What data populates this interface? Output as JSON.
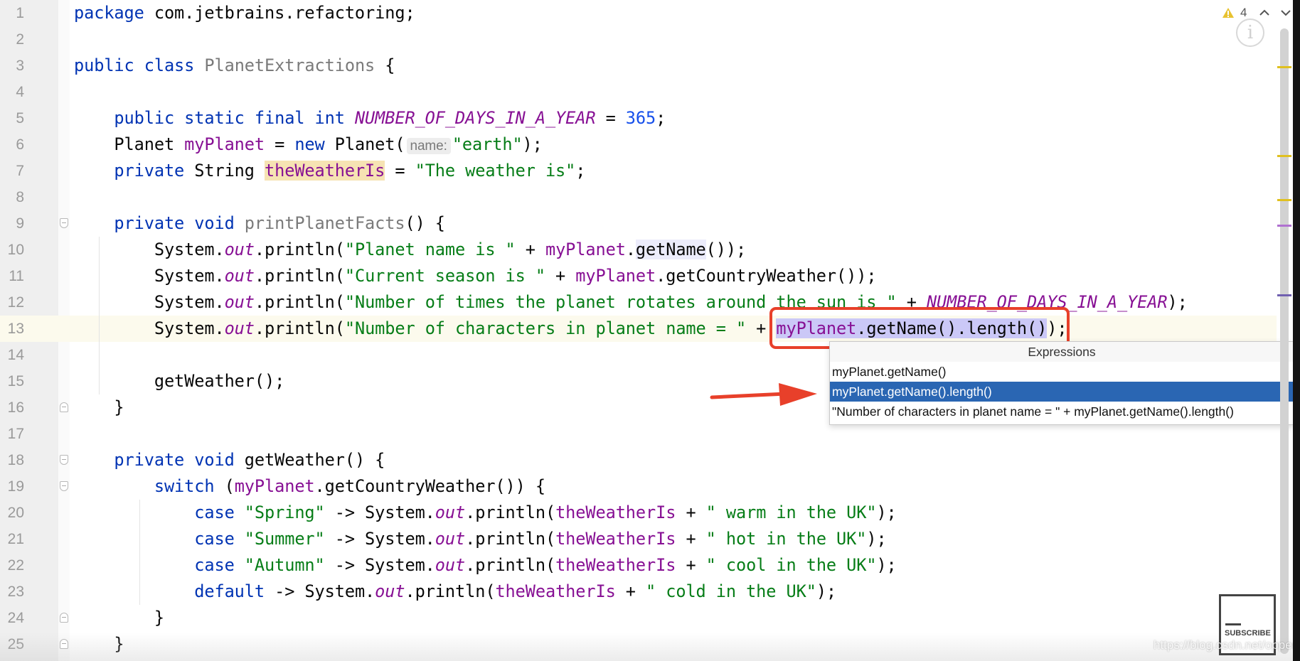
{
  "editor": {
    "current_line": 13,
    "lines": [
      {
        "n": "1",
        "tokens": [
          [
            "package",
            "kw"
          ],
          [
            " com.jetbrains.refactoring;",
            ""
          ]
        ]
      },
      {
        "n": "2",
        "tokens": []
      },
      {
        "n": "3",
        "tokens": [
          [
            "public class",
            "kw"
          ],
          [
            " ",
            ""
          ],
          [
            "PlanetExtractions",
            "unused"
          ],
          [
            " {",
            ""
          ]
        ]
      },
      {
        "n": "4",
        "tokens": []
      },
      {
        "n": "5",
        "tokens": [
          [
            "    ",
            ""
          ],
          [
            "public static final int",
            "kw"
          ],
          [
            " ",
            ""
          ],
          [
            "NUMBER_OF_DAYS_IN_A_YEAR",
            "st"
          ],
          [
            " = ",
            ""
          ],
          [
            "365",
            "num"
          ],
          [
            ";",
            ""
          ]
        ]
      },
      {
        "n": "6",
        "tokens": [
          [
            "    Planet ",
            ""
          ],
          [
            "myPlanet",
            "fld"
          ],
          [
            " = ",
            ""
          ],
          [
            "new",
            "kw"
          ],
          [
            " Planet(",
            ""
          ],
          [
            "name:",
            "hint"
          ],
          [
            "\"earth\"",
            "str"
          ],
          [
            ");",
            ""
          ]
        ]
      },
      {
        "n": "7",
        "tokens": [
          [
            "    ",
            ""
          ],
          [
            "private",
            "kw"
          ],
          [
            " String ",
            ""
          ],
          [
            "theWeatherIs",
            "fld hl-tan"
          ],
          [
            " = ",
            ""
          ],
          [
            "\"The weather is\"",
            "str"
          ],
          [
            ";",
            ""
          ]
        ]
      },
      {
        "n": "8",
        "tokens": []
      },
      {
        "n": "9",
        "tokens": [
          [
            "    ",
            ""
          ],
          [
            "private void",
            "kw"
          ],
          [
            " ",
            ""
          ],
          [
            "printPlanetFacts",
            "unused"
          ],
          [
            "() {",
            ""
          ]
        ]
      },
      {
        "n": "10",
        "tokens": [
          [
            "        System.",
            ""
          ],
          [
            "out",
            "st"
          ],
          [
            ".println(",
            ""
          ],
          [
            "\"Planet name is \"",
            "str"
          ],
          [
            " + ",
            ""
          ],
          [
            "myPlanet",
            "fld"
          ],
          [
            ".",
            ""
          ],
          [
            "getName",
            "hl-lav"
          ],
          [
            "());",
            ""
          ]
        ]
      },
      {
        "n": "11",
        "tokens": [
          [
            "        System.",
            ""
          ],
          [
            "out",
            "st"
          ],
          [
            ".println(",
            ""
          ],
          [
            "\"Current season is \"",
            "str"
          ],
          [
            " + ",
            ""
          ],
          [
            "myPlanet",
            "fld"
          ],
          [
            ".getCountryWeather());",
            ""
          ]
        ]
      },
      {
        "n": "12",
        "tokens": [
          [
            "        System.",
            ""
          ],
          [
            "out",
            "st"
          ],
          [
            ".println(",
            ""
          ],
          [
            "\"Number of times the planet rotates around the sun is \"",
            "str"
          ],
          [
            " + ",
            ""
          ],
          [
            "NUMBER_OF_DAYS_IN_A_YEAR",
            "st"
          ],
          [
            ");",
            ""
          ]
        ]
      },
      {
        "n": "13",
        "tokens": [
          [
            "        System.",
            ""
          ],
          [
            "out",
            "st"
          ],
          [
            ".println(",
            ""
          ],
          [
            "\"Number of characters in planet name = \"",
            "str"
          ],
          [
            " + ",
            ""
          ],
          [
            "myPlanet",
            "fld sel"
          ],
          [
            ".getName().length()",
            "sel"
          ],
          [
            ")",
            ""
          ],
          [
            ";",
            ""
          ]
        ]
      },
      {
        "n": "14",
        "tokens": []
      },
      {
        "n": "15",
        "tokens": [
          [
            "        getWeather();",
            ""
          ]
        ]
      },
      {
        "n": "16",
        "tokens": [
          [
            "    }",
            ""
          ]
        ]
      },
      {
        "n": "17",
        "tokens": []
      },
      {
        "n": "18",
        "tokens": [
          [
            "    ",
            ""
          ],
          [
            "private void",
            "kw"
          ],
          [
            " getWeather() {",
            ""
          ]
        ]
      },
      {
        "n": "19",
        "tokens": [
          [
            "        ",
            ""
          ],
          [
            "switch",
            "kw"
          ],
          [
            " (",
            ""
          ],
          [
            "myPlanet",
            "fld"
          ],
          [
            ".getCountryWeather()) {",
            ""
          ]
        ]
      },
      {
        "n": "20",
        "tokens": [
          [
            "            ",
            ""
          ],
          [
            "case",
            "kw"
          ],
          [
            " ",
            ""
          ],
          [
            "\"Spring\"",
            "str"
          ],
          [
            " -> System.",
            ""
          ],
          [
            "out",
            "st"
          ],
          [
            ".println(",
            ""
          ],
          [
            "theWeatherIs",
            "fld"
          ],
          [
            " + ",
            ""
          ],
          [
            "\" warm in the UK\"",
            "str"
          ],
          [
            ");",
            ""
          ]
        ]
      },
      {
        "n": "21",
        "tokens": [
          [
            "            ",
            ""
          ],
          [
            "case",
            "kw"
          ],
          [
            " ",
            ""
          ],
          [
            "\"Summer\"",
            "str"
          ],
          [
            " -> System.",
            ""
          ],
          [
            "out",
            "st"
          ],
          [
            ".println(",
            ""
          ],
          [
            "theWeatherIs",
            "fld"
          ],
          [
            " + ",
            ""
          ],
          [
            "\" hot in the UK\"",
            "str"
          ],
          [
            ");",
            ""
          ]
        ]
      },
      {
        "n": "22",
        "tokens": [
          [
            "            ",
            ""
          ],
          [
            "case",
            "kw"
          ],
          [
            " ",
            ""
          ],
          [
            "\"Autumn\"",
            "str"
          ],
          [
            " -> System.",
            ""
          ],
          [
            "out",
            "st"
          ],
          [
            ".println(",
            ""
          ],
          [
            "theWeatherIs",
            "fld"
          ],
          [
            " + ",
            ""
          ],
          [
            "\" cool in the UK\"",
            "str"
          ],
          [
            ");",
            ""
          ]
        ]
      },
      {
        "n": "23",
        "tokens": [
          [
            "            ",
            ""
          ],
          [
            "default",
            "kw"
          ],
          [
            " -> System.",
            ""
          ],
          [
            "out",
            "st"
          ],
          [
            ".println(",
            ""
          ],
          [
            "theWeatherIs",
            "fld"
          ],
          [
            " + ",
            ""
          ],
          [
            "\" cold in the UK\"",
            "str"
          ],
          [
            ");",
            ""
          ]
        ]
      },
      {
        "n": "24",
        "tokens": [
          [
            "        }",
            ""
          ]
        ]
      },
      {
        "n": "25",
        "tokens": [
          [
            "    }",
            ""
          ]
        ]
      }
    ],
    "fold_markers": [
      {
        "line": 9,
        "kind": "top"
      },
      {
        "line": 16,
        "kind": "bot"
      },
      {
        "line": 18,
        "kind": "top"
      },
      {
        "line": 19,
        "kind": "top"
      },
      {
        "line": 24,
        "kind": "bot"
      },
      {
        "line": 25,
        "kind": "bot"
      }
    ]
  },
  "inspections": {
    "warning_icon": "warning-triangle-icon",
    "warning_count": "4",
    "prev_icon": "chevron-up-icon",
    "next_icon": "chevron-down-icon",
    "info_icon": "info-circle-icon",
    "info_glyph": "i"
  },
  "popup": {
    "title": "Expressions",
    "selected_index": 1,
    "items": [
      "myPlanet.getName()",
      "myPlanet.getName().length()",
      "\"Number of characters in planet name = \" + myPlanet.getName().length()"
    ]
  },
  "annotation": {
    "color": "#e8402a",
    "arrow_icon": "red-arrow-icon"
  },
  "scrollbar_marks": [
    {
      "line_fraction": 0.06,
      "color": "#e0c020"
    },
    {
      "line_fraction": 0.2,
      "color": "#e0c020"
    },
    {
      "line_fraction": 0.27,
      "color": "#e0c020"
    },
    {
      "line_fraction": 0.31,
      "color": "#b070d0"
    },
    {
      "line_fraction": 0.42,
      "color": "#7060b0"
    }
  ],
  "overlay": {
    "subscribe_label": "SUBSCRIBE",
    "watermark": "https://blog.csdn.net/opperlili"
  }
}
